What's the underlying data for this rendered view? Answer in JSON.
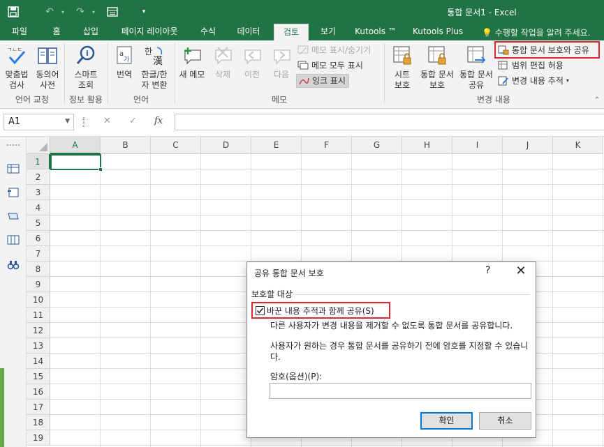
{
  "window": {
    "title": "통합 문서1 - Excel"
  },
  "ribbon_tabs": [
    {
      "label": "파일"
    },
    {
      "label": "홈"
    },
    {
      "label": "삽입"
    },
    {
      "label": "페이지 레이아웃"
    },
    {
      "label": "수식"
    },
    {
      "label": "데이터"
    },
    {
      "label": "검토"
    },
    {
      "label": "보기"
    },
    {
      "label": "Kutools ™"
    },
    {
      "label": "Kutools Plus"
    }
  ],
  "active_tab": "검토",
  "tell_me": "수행할 작업을 알려 주세요.",
  "ribbon": {
    "proofing": {
      "spelling": "맞춤법\n검사",
      "thesaurus": "동의어\n사전",
      "group": "언어 교정"
    },
    "insights": {
      "smart_lookup": "스마트\n조회",
      "group": "정보 활용"
    },
    "language": {
      "translate": "번역",
      "hanja": "한글/한\n자 변환",
      "group": "언어"
    },
    "comments": {
      "new": "새 메모",
      "delete": "삭제",
      "previous": "이전",
      "next": "다음",
      "show_hide": "메모 표시/숨기기",
      "show_all": "메모 모두 표시",
      "show_ink": "잉크 표시",
      "group": "메모"
    },
    "changes": {
      "protect_sheet": "시트\n보호",
      "protect_workbook": "통합 문서\n보호",
      "share_workbook": "통합 문서\n공유",
      "protect_and_share": "통합 문서 보호와 공유",
      "allow_edit_ranges": "범위 편집 허용",
      "track_changes": "변경 내용 추적",
      "group": "변경 내용"
    }
  },
  "formula_bar": {
    "name_box": "A1",
    "fx": "fx",
    "formula": ""
  },
  "grid": {
    "columns": [
      "A",
      "B",
      "C",
      "D",
      "E",
      "F",
      "G",
      "H",
      "I",
      "J",
      "K"
    ],
    "rows": [
      "1",
      "2",
      "3",
      "4",
      "5",
      "6",
      "7",
      "8",
      "9",
      "10",
      "11",
      "12",
      "13",
      "14",
      "15",
      "16",
      "17",
      "18",
      "19"
    ],
    "selected_cell": "A1"
  },
  "dialog": {
    "title": "공유 통합 문서 보호",
    "help": "?",
    "close": "✕",
    "group_title": "보호할 대상",
    "checkbox_label": "바꾼 내용 추적과 함께 공유(S)",
    "checkbox_checked": true,
    "desc1": "다른 사용자가 변경 내용을 제거할 수 없도록 통합 문서를 공유합니다.",
    "desc2": "사용자가 원하는 경우 통합 문서를 공유하기 전에 암호를 지정할 수 있습니다.",
    "password_label": "암호(옵션)(P):",
    "password_value": "",
    "ok": "확인",
    "cancel": "취소"
  },
  "colors": {
    "excel_green": "#217346",
    "highlight_red": "#e0282e",
    "dialog_default_blue": "#0078d7"
  }
}
